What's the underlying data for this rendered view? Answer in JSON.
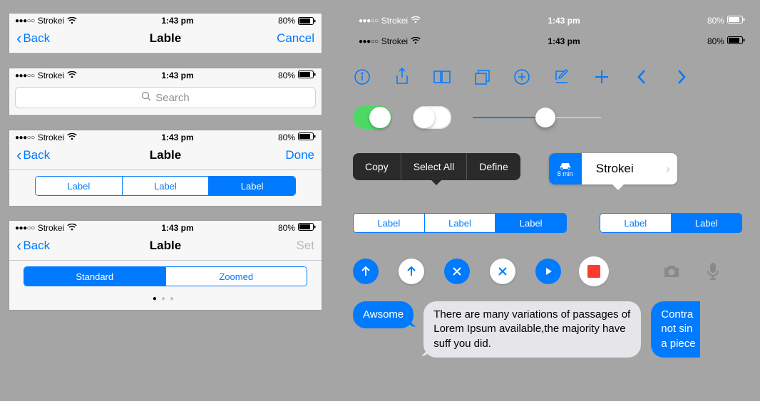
{
  "status": {
    "carrier": "Strokei",
    "time": "1:43 pm",
    "battery": "80%",
    "signal_dots": "●●●○○"
  },
  "nav1": {
    "back": "Back",
    "title": "Lable",
    "right": "Cancel"
  },
  "search": {
    "placeholder": "Search"
  },
  "nav3": {
    "back": "Back",
    "title": "Lable",
    "right": "Done",
    "seg": [
      "Label",
      "Label",
      "Label"
    ]
  },
  "nav4": {
    "back": "Back",
    "title": "Lable",
    "right": "Set",
    "seg": [
      "Standard",
      "Zoomed"
    ]
  },
  "popover": {
    "items": [
      "Copy",
      "Select All",
      "Define"
    ]
  },
  "route": {
    "duration": "8 min",
    "title": "Strokei"
  },
  "segA": [
    "Label",
    "Label",
    "Label"
  ],
  "segB": [
    "Label",
    "Label"
  ],
  "bubble_blue": "Awsome",
  "bubble_gray": "There are many variations of passages of Lorem Ipsum available,the majority have suff you did.",
  "bubble_cut": "Contra\nnot sin\na piece"
}
